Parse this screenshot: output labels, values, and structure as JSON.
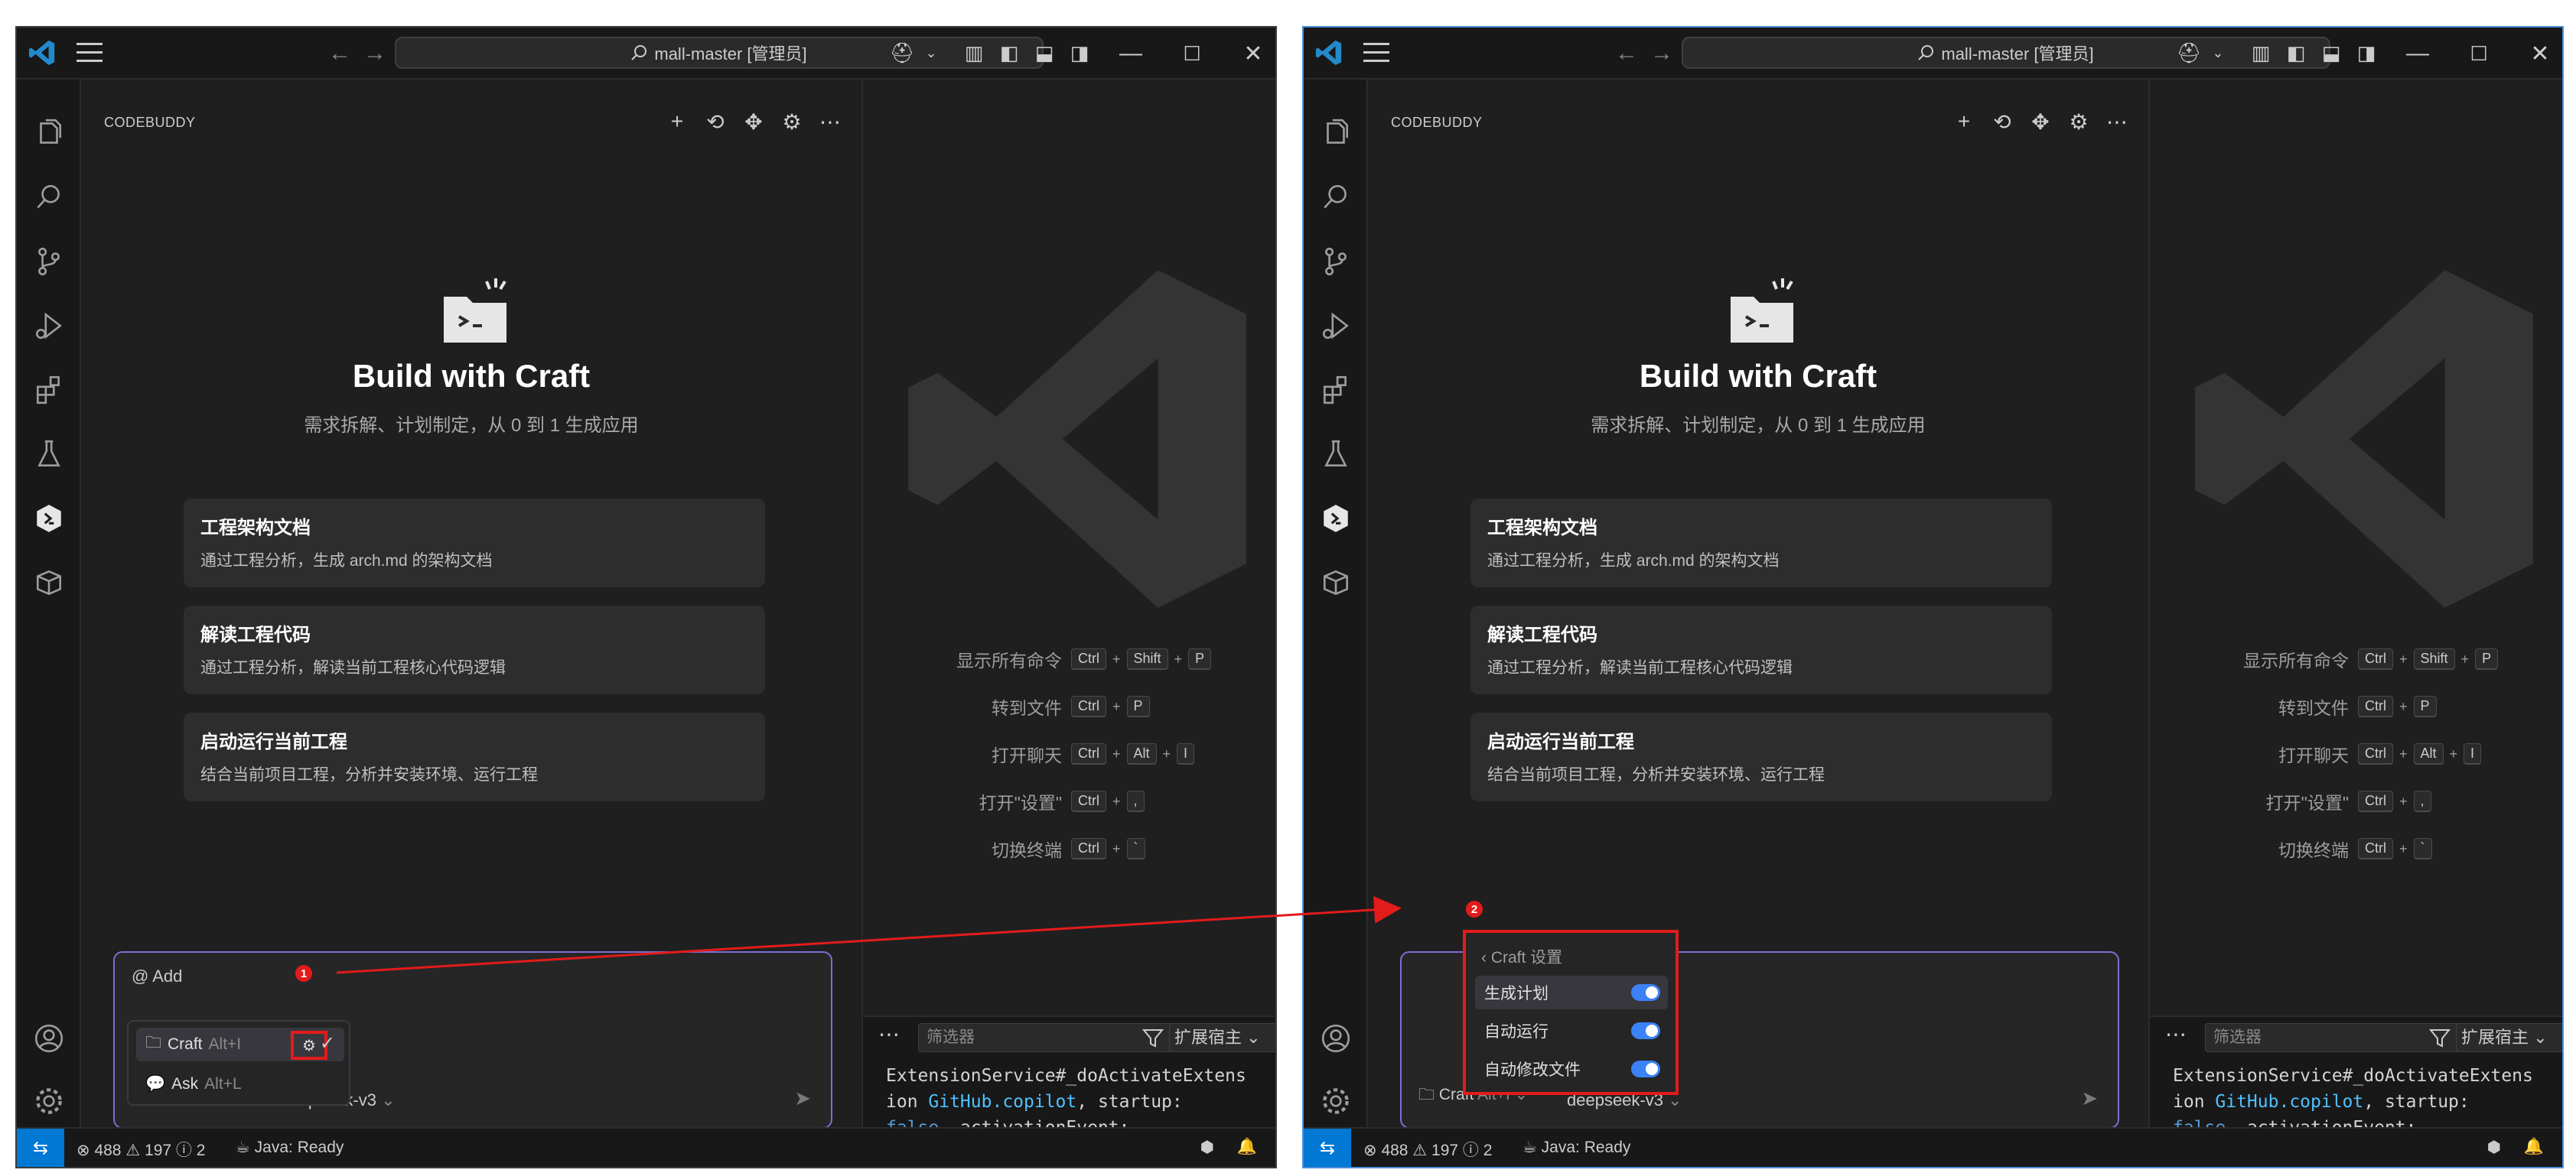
{
  "colors": {
    "accent": "#0078d4",
    "highlight_red": "#e31b1b",
    "composer_border": "#7a6fd6",
    "toggle_on": "#3b82f6"
  },
  "titlebar": {
    "search_text": "mall-master [管理员]",
    "search_icon": "search-icon"
  },
  "sidebar": {
    "title": "CODEBUDDY"
  },
  "hero": {
    "title": "Build with Craft",
    "subtitle": "需求拆解、计划制定，从 0 到 1 生成应用"
  },
  "cards": [
    {
      "title": "工程架构文档",
      "desc": "通过工程分析，生成 arch.md 的架构文档"
    },
    {
      "title": "解读工程代码",
      "desc": "通过工程分析，解读当前工程核心代码逻辑"
    },
    {
      "title": "启动运行当前工程",
      "desc": "结合当前项目工程，分析并安装环境、运行工程"
    }
  ],
  "composer": {
    "add_label": "@ Add",
    "mode_label": "Craft",
    "mode_shortcut": "Alt+I",
    "model_label": "deepseek-v3"
  },
  "mode_popup": {
    "items": [
      {
        "label": "Craft",
        "shortcut": "Alt+I"
      },
      {
        "label": "Ask",
        "shortcut": "Alt+L"
      }
    ]
  },
  "badges": {
    "one": "1",
    "two": "2"
  },
  "shortcuts": [
    {
      "label": "显示所有命令",
      "keys": [
        "Ctrl",
        "+",
        "Shift",
        "+",
        "P"
      ]
    },
    {
      "label": "转到文件",
      "keys": [
        "Ctrl",
        "+",
        "P"
      ]
    },
    {
      "label": "打开聊天",
      "keys": [
        "Ctrl",
        "+",
        "Alt",
        "+",
        "I"
      ]
    },
    {
      "label": "打开\"设置\"",
      "keys": [
        "Ctrl",
        "+",
        ","
      ]
    },
    {
      "label": "切换终端",
      "keys": [
        "Ctrl",
        "+",
        "`"
      ]
    }
  ],
  "panel": {
    "filter_placeholder": "筛选器",
    "select_value": "扩展宿主",
    "log_lines": [
      "ExtensionService#_doActivateExtens",
      "ion ",
      "GitHub.copilot",
      ", startup:",
      "false",
      ", activationEvent:"
    ]
  },
  "statusbar": {
    "errors": "488",
    "warnings": "197",
    "infos": "2",
    "java": "Java: Ready"
  },
  "settings_popup": {
    "back_label": "‹ Craft 设置",
    "items": [
      {
        "label": "生成计划",
        "on": true
      },
      {
        "label": "自动运行",
        "on": true
      },
      {
        "label": "自动修改文件",
        "on": true
      }
    ]
  }
}
